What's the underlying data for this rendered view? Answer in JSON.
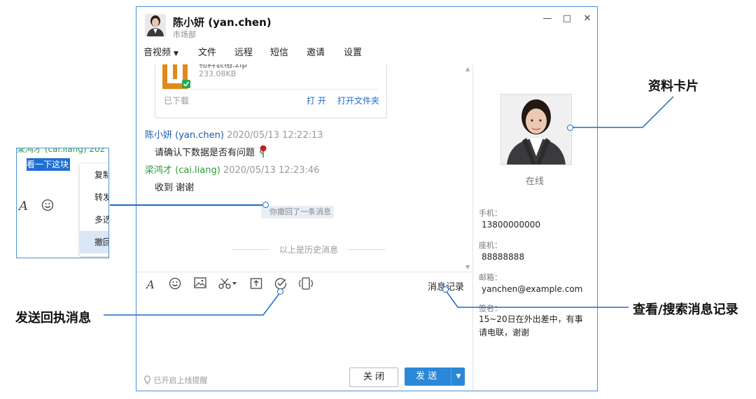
{
  "window": {
    "contact_name": "陈小妍 (yan.chen)",
    "department": "市场部",
    "controls": [
      "minimize-icon",
      "maximize-icon",
      "close-icon"
    ]
  },
  "menu": [
    "音视频",
    "文件",
    "远程",
    "短信",
    "邀请",
    "设置"
  ],
  "file_message": {
    "name": "物料表格.zip",
    "size": "233.08KB",
    "status": "已下载",
    "open": "打 开",
    "open_folder": "打开文件夹"
  },
  "messages": [
    {
      "sender": "陈小妍 (yan.chen)",
      "time": "2020/05/13 12:22:13",
      "text": "请确认下数据是否有问题",
      "sender_color": "#1d5bb0"
    },
    {
      "sender": "梁鸿才 (cai.liang)",
      "time": "2020/05/13 12:23:46",
      "text": "收到 谢谢",
      "sender_color": "#2c9b3c"
    }
  ],
  "recall_note": "你撤回了一条消息",
  "history_divider": "以上是历史消息",
  "toolbar": {
    "icons": [
      "font-icon",
      "emoji-icon",
      "image-icon",
      "screenshot-icon",
      "upload-file-icon",
      "receipt-check-icon",
      "shake-icon"
    ],
    "message_record": "消息记录"
  },
  "footer": {
    "online_remind": "已开启上线提醒",
    "close_button": "关 闭",
    "send_button": "发 送"
  },
  "profile": {
    "status": "在线",
    "phone_label": "手机：",
    "phone": "13800000000",
    "landline_label": "座机：",
    "landline": "88888888",
    "email_label": "邮箱：",
    "email": "yanchen@example.com",
    "signature_label": "签名：",
    "signature": "15~20日在外出差中，有事请电联，谢谢"
  },
  "popup": {
    "partial_sender": "梁鸿才 (cai.liang) 202",
    "selected_text": "看一下这块",
    "context_menu": [
      "复制",
      "转发",
      "多选",
      "撤回"
    ],
    "active_item": "撤回"
  },
  "callouts": {
    "profile_card": "资料卡片",
    "receipt_message": "发送回执消息",
    "search_record": "查看/搜索消息记录"
  },
  "colors": {
    "accent": "#2b88d8",
    "callout": "#1a6cc7",
    "sender_blue": "#1d5bb0",
    "sender_green": "#2c9b3c"
  }
}
